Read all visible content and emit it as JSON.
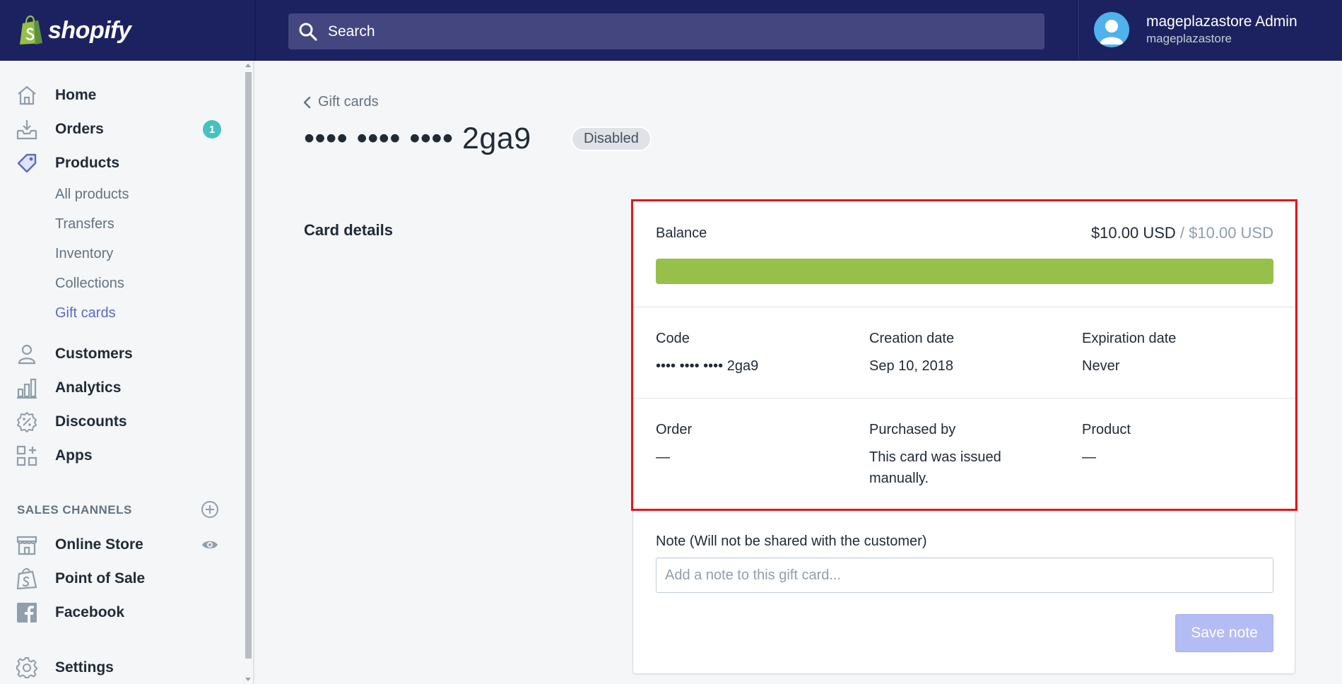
{
  "app": {
    "logo_text": "shopify",
    "search_placeholder": "Search",
    "user_name": "mageplazastore Admin",
    "user_store": "mageplazastore"
  },
  "sidebar": {
    "items": [
      {
        "label": "Home",
        "icon": "home-icon"
      },
      {
        "label": "Orders",
        "icon": "orders-icon",
        "badge": "1"
      },
      {
        "label": "Products",
        "icon": "tag-icon"
      },
      {
        "label": "Customers",
        "icon": "person-icon"
      },
      {
        "label": "Analytics",
        "icon": "bar-chart-icon"
      },
      {
        "label": "Discounts",
        "icon": "discount-icon"
      },
      {
        "label": "Apps",
        "icon": "apps-grid-icon"
      }
    ],
    "product_sub_items": [
      "All products",
      "Transfers",
      "Inventory",
      "Collections",
      "Gift cards"
    ],
    "active_sub_item": "Gift cards",
    "sales_channels_title": "SALES CHANNELS",
    "channels": [
      {
        "label": "Online Store",
        "icon": "store-icon"
      },
      {
        "label": "Point of Sale",
        "icon": "pos-bag-icon"
      },
      {
        "label": "Facebook",
        "icon": "facebook-icon"
      }
    ],
    "settings_label": "Settings"
  },
  "main": {
    "breadcrumb": "Gift cards",
    "title": "•••• •••• •••• 2ga9",
    "status": "Disabled",
    "section_label": "Card details",
    "card": {
      "balance_label": "Balance",
      "balance_current": "$10.00 USD",
      "balance_separator": " / ",
      "balance_initial": "$10.00 USD",
      "balance_fraction": 1.0,
      "progress_color": "#96c049",
      "code_label": "Code",
      "code_value": "•••• •••• •••• 2ga9",
      "creation_label": "Creation date",
      "creation_value": "Sep 10, 2018",
      "expiration_label": "Expiration date",
      "expiration_value": "Never",
      "order_label": "Order",
      "order_value": "—",
      "purchased_label": "Purchased by",
      "purchased_value": "This card was issued manually.",
      "product_label": "Product",
      "product_value": "—",
      "note_label": "Note (Will not be shared with the customer)",
      "note_placeholder": "Add a note to this gift card...",
      "save_label": "Save note"
    }
  },
  "colors": {
    "topbar": "#1c2260",
    "accent": "#5c6ac4",
    "highlight": "#e6141c"
  }
}
